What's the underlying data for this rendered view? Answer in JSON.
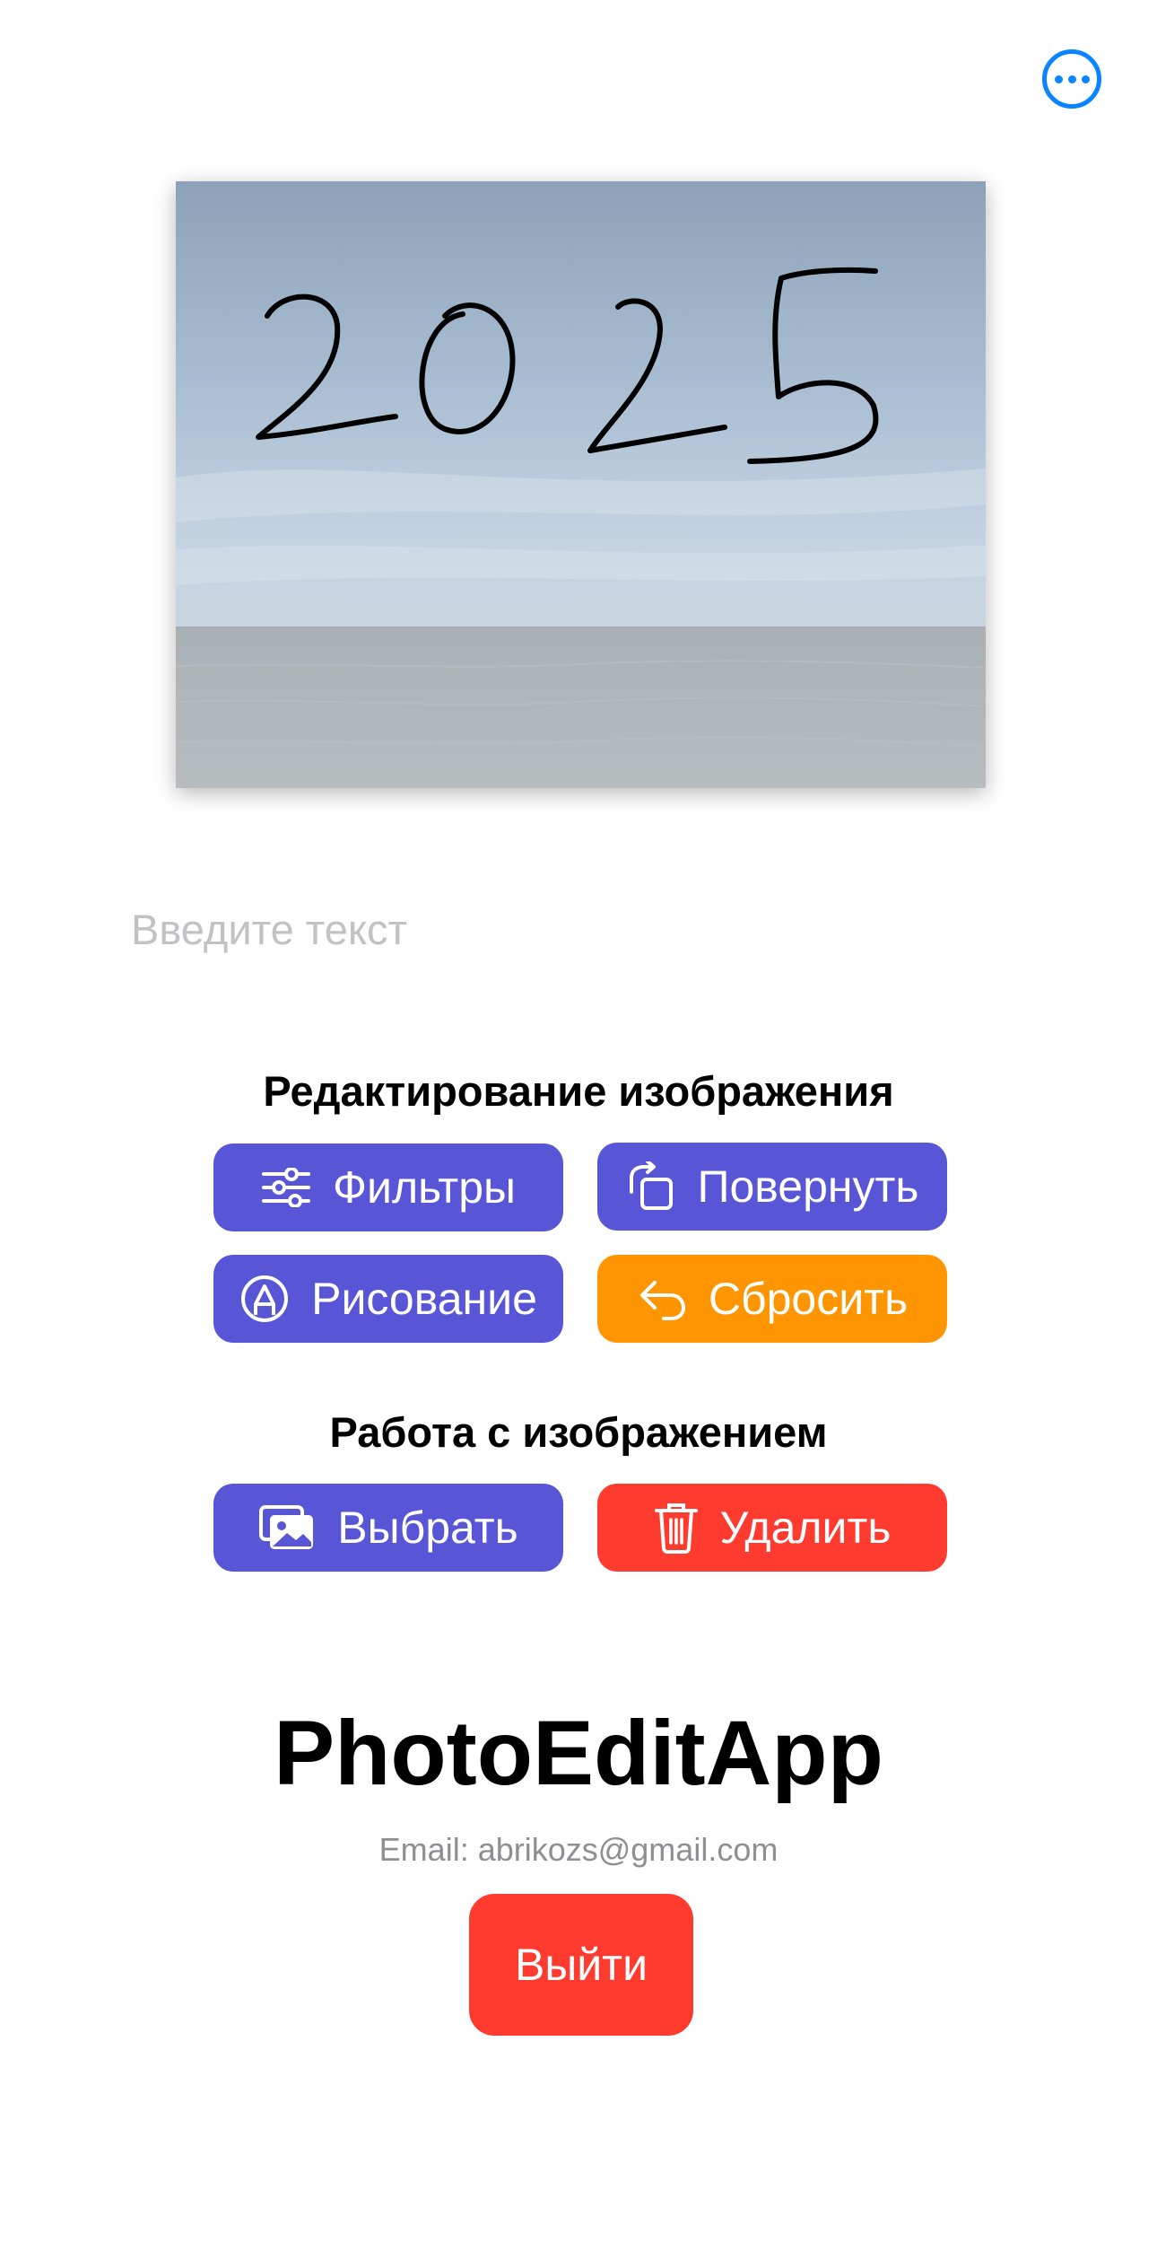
{
  "toolbar": {
    "more_icon": "ellipsis-circle-icon",
    "accent_color": "#0a84ff"
  },
  "photo": {
    "drawn_text": "2025",
    "description_icon": "photo-with-drawing"
  },
  "text_input": {
    "placeholder": "Введите текст",
    "value": ""
  },
  "editing_section": {
    "title": "Редактирование изображения",
    "filters_label": "Фильтры",
    "filters_icon": "sliders-icon",
    "rotate_label": "Повернуть",
    "rotate_icon": "rotate-icon",
    "draw_label": "Рисование",
    "draw_icon": "pencil-tip-circle-icon",
    "reset_label": "Сбросить",
    "reset_icon": "undo-arrow-icon"
  },
  "image_section": {
    "title": "Работа с изображением",
    "select_label": "Выбрать",
    "select_icon": "photos-icon",
    "delete_label": "Удалить",
    "delete_icon": "trash-icon"
  },
  "footer": {
    "app_title": "PhotoEditApp",
    "email_text": "Email: abrikozs@gmail.com",
    "logout_label": "Выйти"
  },
  "colors": {
    "purple": "#5856d6",
    "orange": "#ff9500",
    "red": "#ff3b30",
    "placeholder_gray": "#c2c2c6",
    "secondary_gray": "#8e8e93"
  }
}
